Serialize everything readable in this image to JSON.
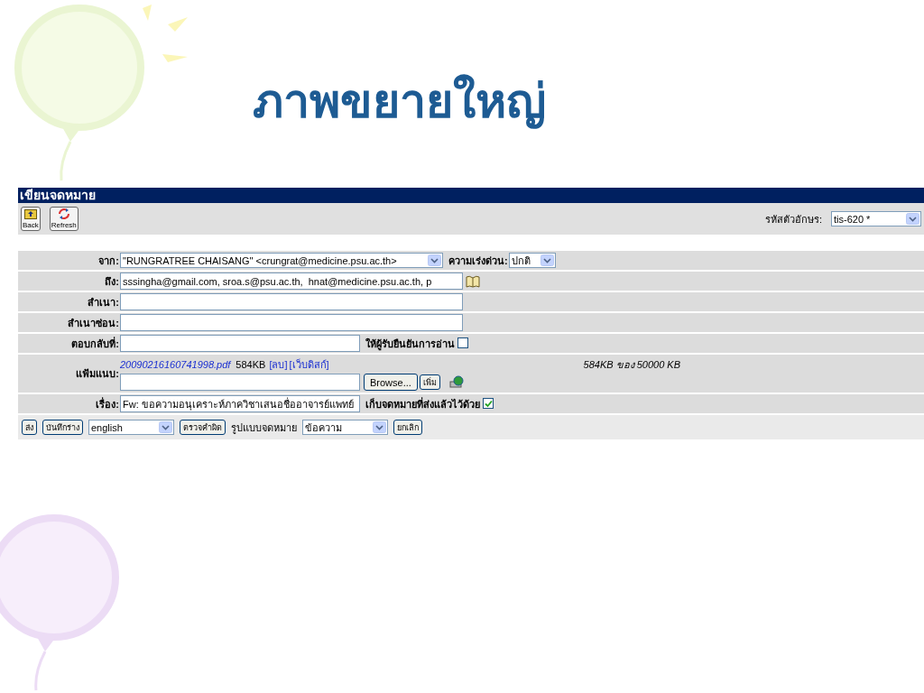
{
  "slide": {
    "title": "ภาพขยายใหญ่"
  },
  "compose": {
    "title": "เขียนจดหมาย",
    "toolbar": [
      {
        "label": "Back",
        "kind": "back"
      },
      {
        "label": "Refresh",
        "kind": "refresh"
      }
    ],
    "charset": {
      "label": "รหัสตัวอักษร:",
      "value": "tis-620 *"
    },
    "from": {
      "label": "จาก:",
      "value": "\"RUNGRATREE CHAISANG\" <crungrat@medicine.psu.ac.th>"
    },
    "priority": {
      "label": "ความเร่งด่วน:",
      "value": "ปกติ"
    },
    "to": {
      "label": "ถึง:",
      "value": "sssingha@gmail.com, sroa.s@psu.ac.th,  hnat@medicine.psu.ac.th, p"
    },
    "cc": {
      "label": "สำเนา:"
    },
    "bcc": {
      "label": "สำเนาซ่อน:"
    },
    "reply_to": {
      "label": "ตอบกลับที่:"
    },
    "read_receipt": {
      "label": "ให้ผู้รับยืนยันการอ่าน",
      "checked": false
    },
    "attachments": {
      "label": "แฟ้มแนบ:",
      "files": [
        {
          "name": "20090216160741998.pdf",
          "size": "584KB",
          "delete": "[ลบ]",
          "web_disk": "[เว็บดิสก์]"
        }
      ],
      "quota": "584KB ของ 50000 KB",
      "browse": "Browse...",
      "add": "เพิ่ม"
    },
    "subject": {
      "label": "เรื่อง:",
      "value": "Fw: ขอความอนุเคราะห์ภาควิชาเสนอชื่ออาจารย์แพทย์"
    },
    "save_copy": {
      "label": "เก็บจดหมายที่ส่งแล้วไว้ด้วย",
      "checked": true
    },
    "actions": [
      {
        "kind": "button",
        "label": "ส่ง"
      },
      {
        "kind": "button",
        "label": "บันทึกร่าง"
      },
      {
        "kind": "select",
        "value": "english"
      },
      {
        "kind": "button",
        "label": "ตรวจคำผิด"
      },
      {
        "kind": "text",
        "label": "รูปแบบจดหมาย"
      },
      {
        "kind": "select",
        "value": "ข้อความ"
      },
      {
        "kind": "button",
        "label": "ยกเลิก"
      }
    ]
  }
}
